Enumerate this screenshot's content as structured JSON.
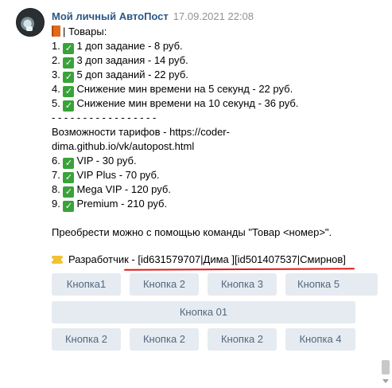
{
  "message": {
    "author": "Мой личный АвтоПост",
    "date": "17.09.2021 22:08",
    "header_line": "| Товары:",
    "items": [
      "1 доп задание - 8 руб.",
      "3 доп задания - 14 руб.",
      "5 доп заданий - 22 руб.",
      "Снижение мин времени на 5 секунд - 22 руб.",
      "Снижение мин времени на 10 секунд - 36 руб."
    ],
    "item_numbers": [
      "1.",
      "2.",
      "3.",
      "4.",
      "5."
    ],
    "separator": "- - - - - - - - - - - - - - - - -",
    "tariffs_line1": "Возможности тарифов - https://coder-",
    "tariffs_line2": "dima.github.io/vk/autopost.html",
    "tariffs": [
      "VIP - 30 руб.",
      "VIP Plus - 70 руб.",
      "Mega VIP - 120 руб.",
      "Premium - 210 руб."
    ],
    "tariff_numbers": [
      "6.",
      "7.",
      "8.",
      "9."
    ],
    "purchase_hint": "Преобрести можно с помощью команды \"Товар <номер>\".",
    "developer": "Разработчик - [id631579707|Дима ][id501407537|Смирнов]"
  },
  "keyboard": {
    "row1": [
      "Кнопка1",
      "Кнопка 2",
      "Кнопка 3",
      "Кнопка 5"
    ],
    "row2": [
      "Кнопка 01"
    ],
    "row3": [
      "Кнопка 2",
      "Кнопка 2",
      "Кнопка 2",
      "Кнопка 4"
    ]
  },
  "icons": {
    "avatar": "avatar-image",
    "book": "orange-book-icon",
    "check": "green-check-icon",
    "ticket": "ticket-icon"
  },
  "colors": {
    "author": "#2a5885",
    "date": "#939393",
    "button_bg": "#e5ebf1",
    "button_text": "#55677d",
    "check": "#3aa23a",
    "underline": "#e01818"
  }
}
